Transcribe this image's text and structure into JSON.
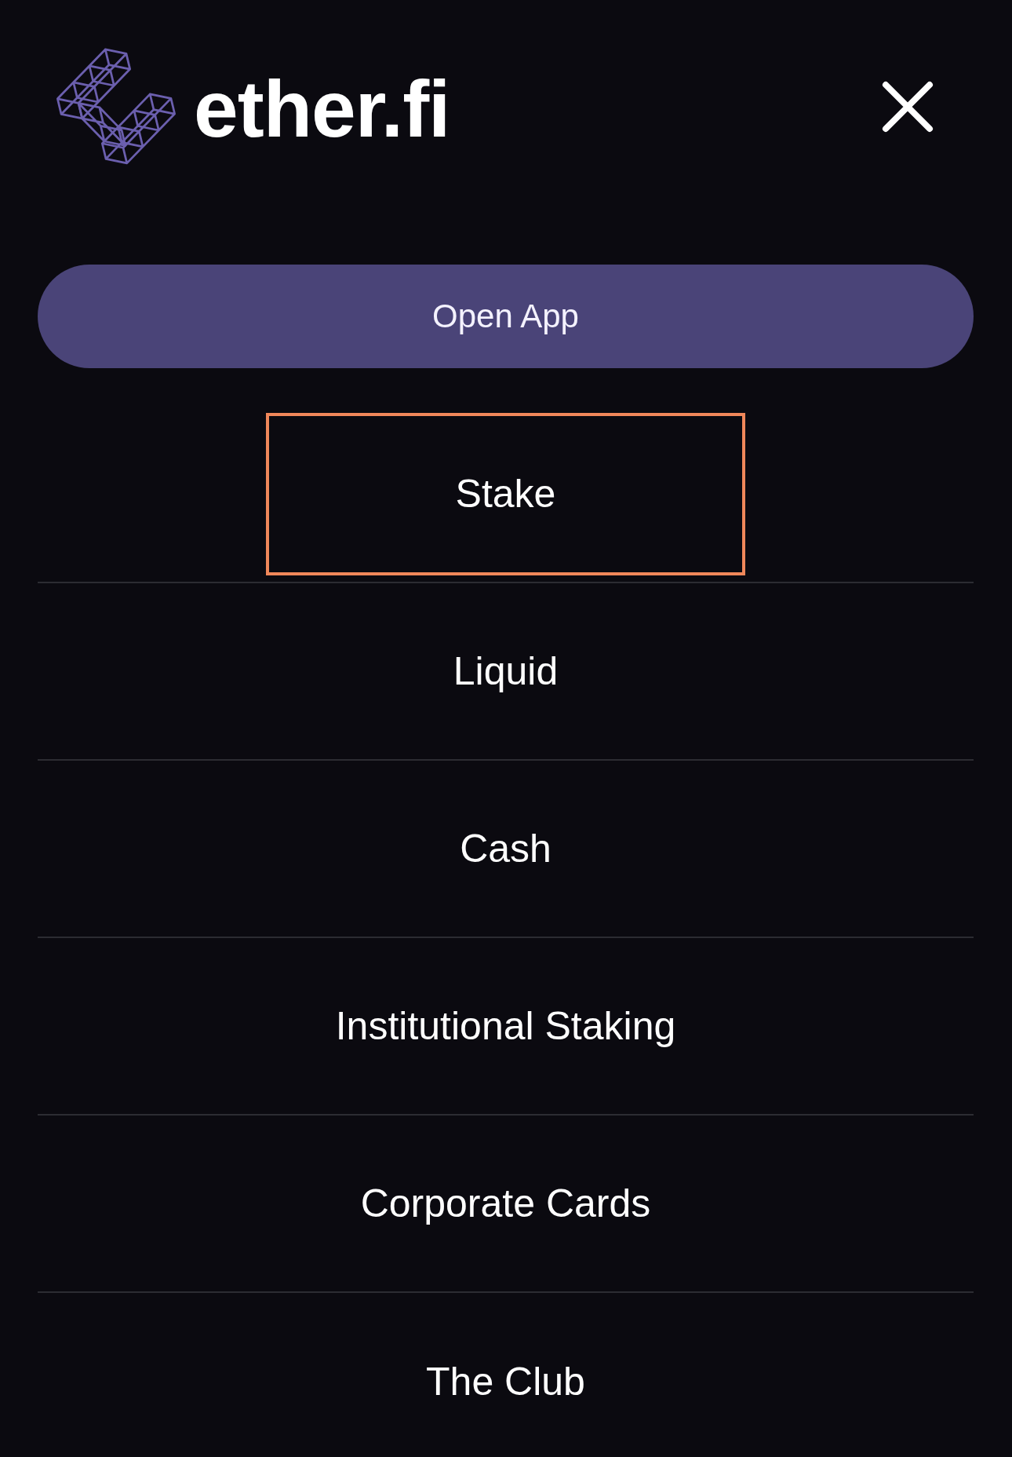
{
  "header": {
    "logo_text": "ether.fi"
  },
  "open_app_button": {
    "label": "Open App"
  },
  "menu": {
    "items": [
      {
        "label": "Stake",
        "focused": true
      },
      {
        "label": "Liquid",
        "focused": false
      },
      {
        "label": "Cash",
        "focused": false
      },
      {
        "label": "Institutional Staking",
        "focused": false
      },
      {
        "label": "Corporate Cards",
        "focused": false
      },
      {
        "label": "The Club",
        "focused": false
      }
    ]
  }
}
